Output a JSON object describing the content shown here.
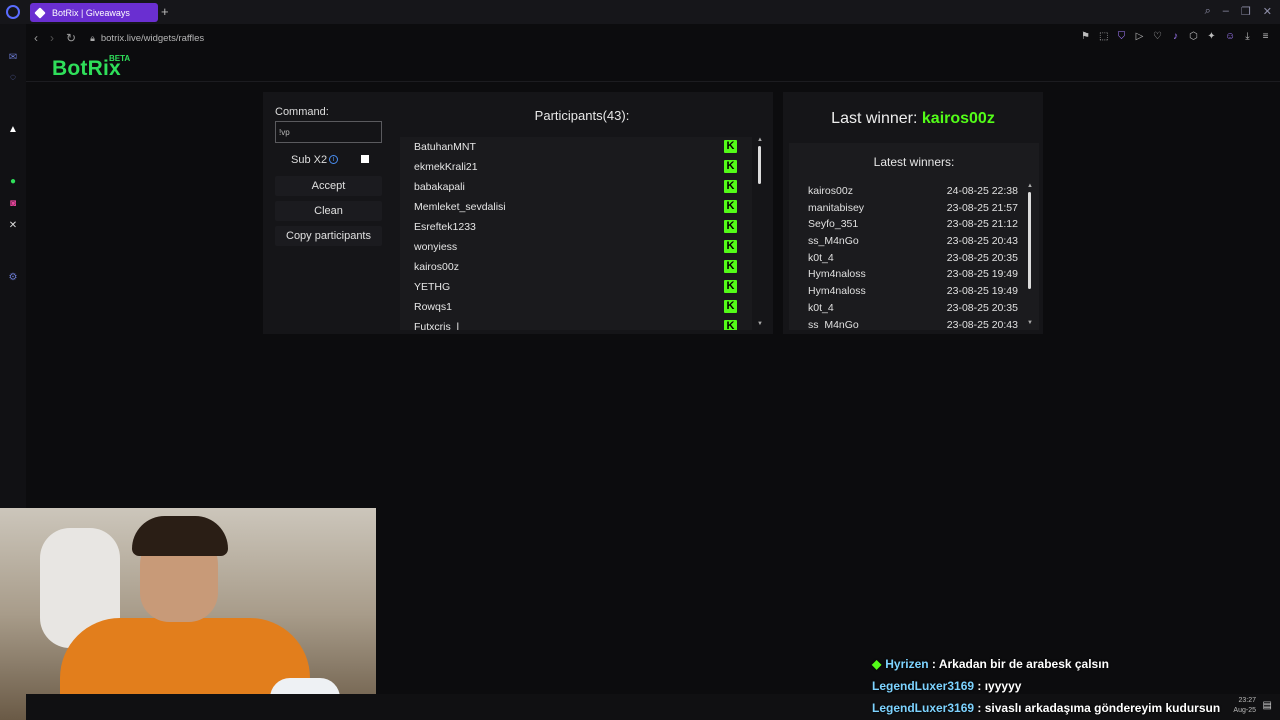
{
  "browser": {
    "tab_title": "BotRix | Giveaways",
    "new_tab": "+",
    "url": "botrix.live/widgets/raffles"
  },
  "brand": {
    "name": "BotRix",
    "badge": "BETA"
  },
  "raffle": {
    "command_label": "Command:",
    "command_value": "!vp",
    "sub_label": "Sub X2",
    "sub_checked": false,
    "accept_label": "Accept",
    "clean_label": "Clean",
    "copy_label": "Copy participants"
  },
  "participants": {
    "title": "Participants(43):",
    "items": [
      "BatuhanMNT",
      "ekmekKrali21",
      "babakapali",
      "Memleket_sevdalisi",
      "Esreftek1233",
      "wonyiess",
      "kairos00z",
      "YETHG",
      "Rowqs1",
      "Futxcris_l"
    ]
  },
  "winners": {
    "last_label": "Last winner:",
    "last_name": "kairos00z",
    "latest_title": "Latest winners:",
    "rows": [
      {
        "name": "kairos00z",
        "time": "24-08-25 22:38"
      },
      {
        "name": "manitabisey",
        "time": "23-08-25 21:57"
      },
      {
        "name": "Seyfo_351",
        "time": "23-08-25 21:12"
      },
      {
        "name": "ss_M4nGo",
        "time": "23-08-25 20:43"
      },
      {
        "name": "k0t_4",
        "time": "23-08-25 20:35"
      },
      {
        "name": "Hym4naloss",
        "time": "23-08-25 19:49"
      },
      {
        "name": "Hym4naloss",
        "time": "23-08-25 19:49"
      },
      {
        "name": "k0t_4",
        "time": "23-08-25 20:35"
      },
      {
        "name": "ss_M4nGo",
        "time": "23-08-25 20:43"
      }
    ]
  },
  "chat": [
    {
      "user": "Hyrizen",
      "sep": " : ",
      "msg": "Arkadan bir de arabesk çalsın"
    },
    {
      "user": "LegendLuxer3169",
      "sep": " : ",
      "msg": "ıyyyyy"
    },
    {
      "user": "LegendLuxer3169",
      "sep": " : ",
      "msg": "sivaslı arkadaşıma göndereyim kudursun"
    }
  ],
  "taskbar": {
    "time": "23:27",
    "date": "Aug-25"
  },
  "colors": {
    "accent": "#53fc18",
    "tab": "#6a2fd1"
  }
}
